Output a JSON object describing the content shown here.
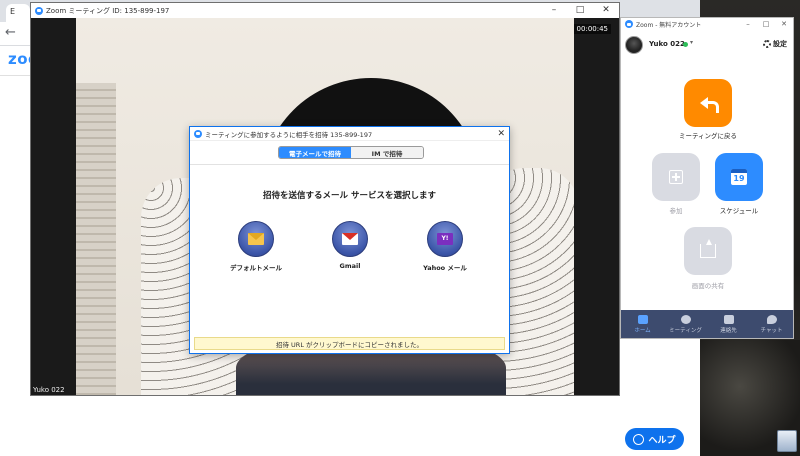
{
  "browser": {
    "tab_label": "E",
    "logo": "zoom"
  },
  "help_button": {
    "label": "ヘルプ"
  },
  "meeting": {
    "title": "Zoom ミーティング ID: 135-899-197",
    "timer": "00:00:45",
    "participant_name": "Yuko 022"
  },
  "invite_dialog": {
    "title": "ミーティングに参加するように相手を招待 135-899-197",
    "tabs": [
      {
        "label": "電子メールで招待",
        "active": true
      },
      {
        "label": "IM で招待",
        "active": false
      }
    ],
    "heading": "招待を送信するメール サービスを選択します",
    "services": [
      {
        "label": "デフォルトメール",
        "icon": "default-mail-icon"
      },
      {
        "label": "Gmail",
        "icon": "gmail-icon"
      },
      {
        "label": "Yahoo メール",
        "icon": "yahoo-mail-icon",
        "glyph": "Y!"
      }
    ],
    "notice": "招待 URL がクリップボードにコピーされました。"
  },
  "home_panel": {
    "title": "Zoom - 無料アカウント",
    "user_name": "Yuko 022",
    "settings_label": "設定",
    "tiles": [
      {
        "label": "ミーティングに戻る",
        "icon": "return-arrow-icon",
        "enabled": true
      },
      {
        "label": "参加",
        "icon": "plus-icon",
        "enabled": false
      },
      {
        "label": "スケジュール",
        "icon": "calendar-icon",
        "enabled": true,
        "glyph": "19"
      },
      {
        "label": "画面の共有",
        "icon": "share-screen-icon",
        "enabled": false
      }
    ],
    "nav": [
      {
        "label": "ホーム",
        "icon": "home-icon",
        "active": true
      },
      {
        "label": "ミーティング",
        "icon": "clock-icon",
        "active": false
      },
      {
        "label": "連絡先",
        "icon": "contacts-icon",
        "active": false
      },
      {
        "label": "チャット",
        "icon": "chat-icon",
        "active": false
      }
    ]
  },
  "colors": {
    "zoom_blue": "#2d8cff",
    "orange_tile": "#ff8a00",
    "nav_bar": "#3d4b6e",
    "notice_bg": "#fff8cf"
  }
}
